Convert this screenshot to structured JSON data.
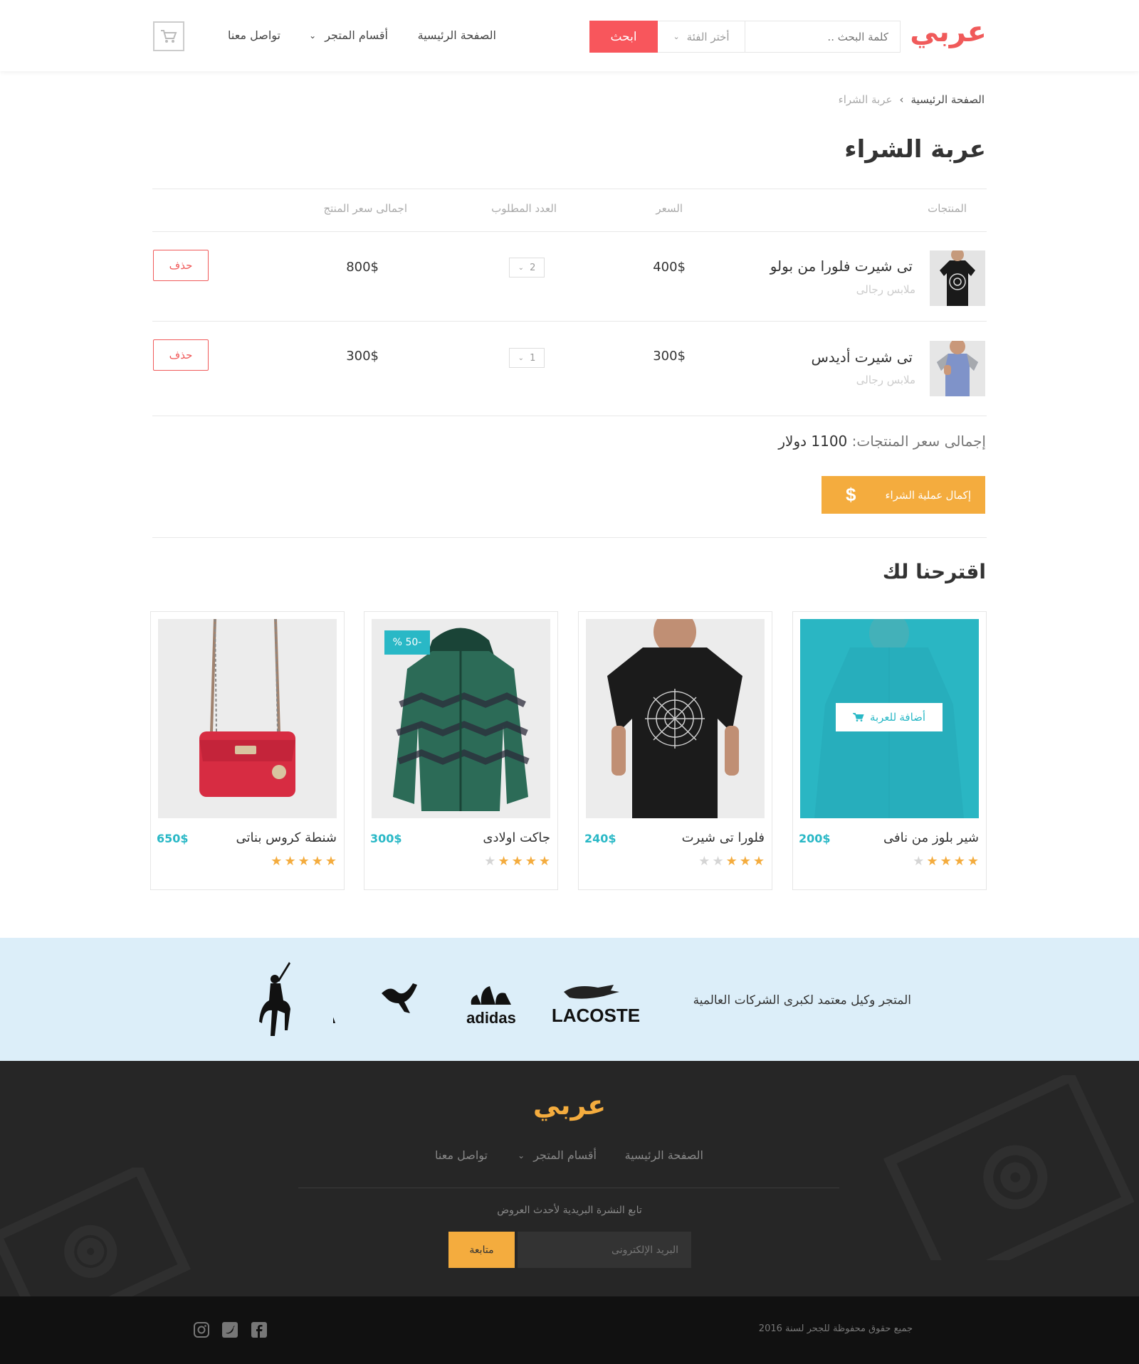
{
  "header": {
    "logo": "عربي",
    "search_placeholder": "كلمة البحث ..",
    "category_select": "أختر الفئة",
    "search_button": "ابحث",
    "nav": {
      "home": "الصفحة الرئيسية",
      "sections": "أقسام المتجر",
      "contact": "تواصل معنا"
    }
  },
  "breadcrumb": {
    "home": "الصفحة الرئيسية",
    "separator": "›",
    "current": "عربة الشراء"
  },
  "page_title": "عربة الشراء",
  "table": {
    "headers": {
      "products": "المنتجات",
      "price": "السعر",
      "quantity": "العدد المطلوب",
      "total": "اجمالى سعر المنتج"
    },
    "rows": [
      {
        "name": "تى شيرت فلورا من بولو",
        "category": "ملابس رجالى",
        "price": "400$",
        "quantity": "2",
        "total": "800$",
        "delete_label": "حذف"
      },
      {
        "name": "تى شيرت أديدس",
        "category": "ملابس رجالى",
        "price": "300$",
        "quantity": "1",
        "total": "300$",
        "delete_label": "حذف"
      }
    ]
  },
  "summary": {
    "total_label": "إجمالى سعر المنتجات:",
    "total_value": "1100 دولار",
    "checkout_button": "إكمال عملية الشراء",
    "checkout_icon": "$"
  },
  "suggestions": {
    "title": "اقترحنا لك",
    "add_to_cart": "أضافة للعربة",
    "items": [
      {
        "name": "شير بلوز من نافى",
        "price": "200$",
        "rating": 4,
        "image": "teal-blouse"
      },
      {
        "name": "فلورا تى شيرت",
        "price": "240$",
        "rating": 3,
        "image": "black-tshirt"
      },
      {
        "name": "جاكت اولادى",
        "price": "300$",
        "rating": 4,
        "badge": "-50 %",
        "image": "green-jacket"
      },
      {
        "name": "شنطة كروس بناتى",
        "price": "650$",
        "rating": 5,
        "image": "red-handbag"
      }
    ]
  },
  "brands": {
    "text": "المتجر وكيل معتمد لكبرى الشركات العالمية",
    "logos": [
      "LACOSTE",
      "adidas",
      "PUMA",
      "polo-ralph-lauren"
    ]
  },
  "footer": {
    "logo": "عربي",
    "nav": {
      "home": "الصفحة الرئيسية",
      "sections": "أقسام المتجر",
      "contact": "تواصل معنا"
    },
    "newsletter_text": "تابع النشرة البريدية لأحدث العروض",
    "email_placeholder": "البريد الإلكترونى",
    "follow_button": "متابعة",
    "copyright": "جميع حقوق محفوظة للجحر لسنة 2016",
    "social": [
      "instagram-icon",
      "twitter-icon",
      "facebook-icon"
    ]
  },
  "colors": {
    "accent_red": "#f8565c",
    "accent_orange": "#f4ac3e",
    "accent_teal": "#29b8c6",
    "brands_bg": "#dceef9",
    "footer_bg": "#262626"
  }
}
